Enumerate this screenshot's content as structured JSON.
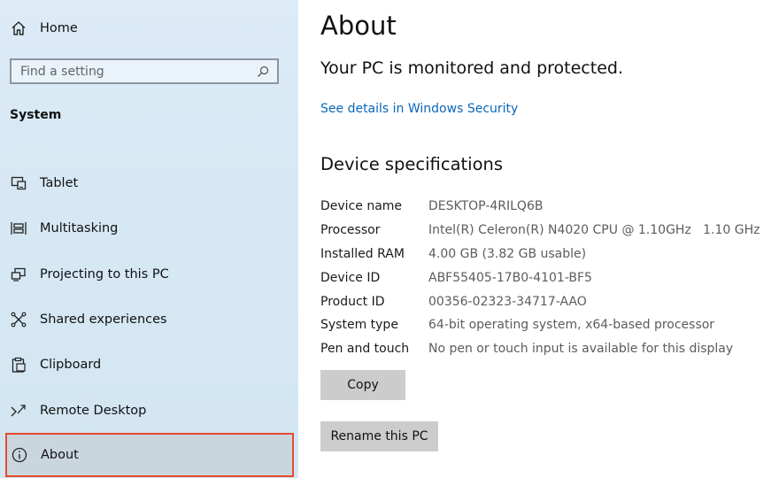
{
  "sidebar": {
    "home_label": "Home",
    "search_placeholder": "Find a setting",
    "section_title": "System",
    "items": [
      {
        "label": "Tablet",
        "icon": "tablet-icon"
      },
      {
        "label": "Multitasking",
        "icon": "multitasking-icon"
      },
      {
        "label": "Projecting to this PC",
        "icon": "projecting-icon"
      },
      {
        "label": "Shared experiences",
        "icon": "shared-experiences-icon"
      },
      {
        "label": "Clipboard",
        "icon": "clipboard-icon"
      },
      {
        "label": "Remote Desktop",
        "icon": "remote-desktop-icon"
      },
      {
        "label": "About",
        "icon": "info-icon",
        "selected": true
      }
    ]
  },
  "main": {
    "title": "About",
    "protection_status": "Your PC is monitored and protected.",
    "security_link": "See details in Windows Security",
    "specs_title": "Device specifications",
    "specs": [
      {
        "key": "Device name",
        "value": "DESKTOP-4RILQ6B"
      },
      {
        "key": "Processor",
        "value": "Intel(R) Celeron(R) N4020 CPU @ 1.10GHz   1.10 GHz"
      },
      {
        "key": "Installed RAM",
        "value": "4.00 GB (3.82 GB usable)"
      },
      {
        "key": "Device ID",
        "value": "ABF55405-17B0-4101-BF5"
      },
      {
        "key": "Product ID",
        "value": "00356-02323-34717-AAO"
      },
      {
        "key": "System type",
        "value": "64-bit operating system, x64-based processor"
      },
      {
        "key": "Pen and touch",
        "value": "No pen or touch input is available for this display"
      }
    ],
    "copy_button": "Copy",
    "rename_button": "Rename this PC"
  },
  "colors": {
    "selection_outline": "#e64a2e",
    "link": "#0a66b8",
    "sidebar_bg": "#d6e8f4"
  }
}
